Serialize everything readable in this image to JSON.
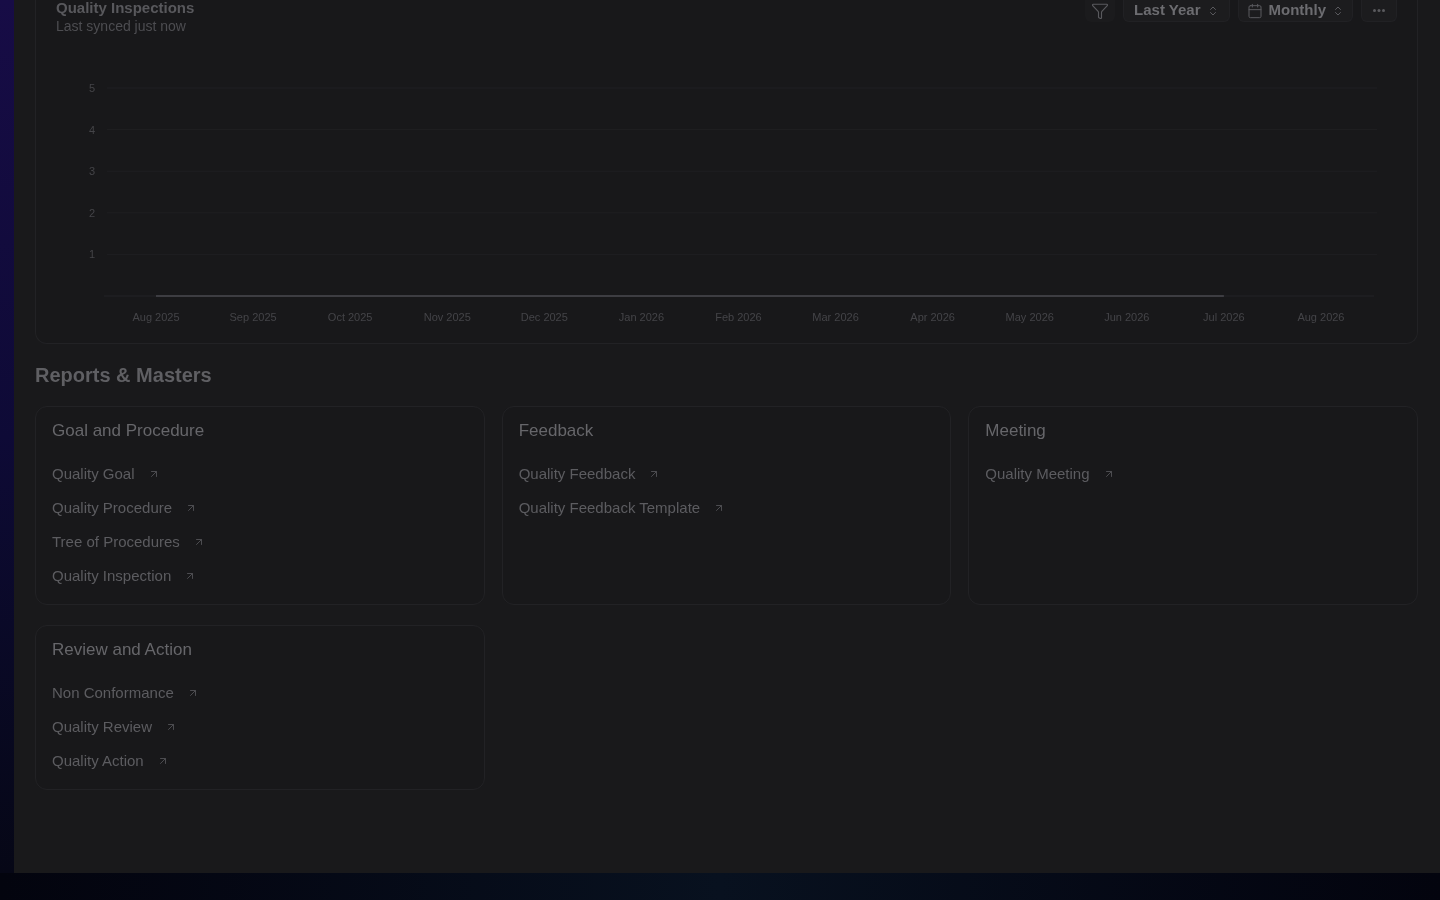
{
  "chart_card": {
    "title": "Quality Inspections",
    "subtitle": "Last synced just now",
    "range_select": {
      "value": "Last Year"
    },
    "interval_select": {
      "value": "Monthly"
    },
    "chart_data": {
      "type": "line",
      "categories": [
        "Aug 2025",
        "Sep 2025",
        "Oct 2025",
        "Nov 2025",
        "Dec 2025",
        "Jan 2026",
        "Feb 2026",
        "Mar 2026",
        "Apr 2026",
        "May 2026",
        "Jun 2026",
        "Jul 2026",
        "Aug 2026"
      ],
      "series": [
        {
          "color": "#3d3d42",
          "values": [
            0,
            0,
            0,
            0,
            0,
            0,
            0,
            0,
            0,
            0,
            0,
            0,
            null
          ]
        }
      ],
      "ylim": [
        0,
        5
      ],
      "yticks": [
        1,
        2,
        3,
        4,
        5
      ]
    }
  },
  "reports": {
    "title": "Reports & Masters",
    "groups": [
      {
        "title": "Goal and Procedure",
        "links": [
          "Quality Goal",
          "Quality Procedure",
          "Tree of Procedures",
          "Quality Inspection"
        ]
      },
      {
        "title": "Feedback",
        "links": [
          "Quality Feedback",
          "Quality Feedback Template"
        ]
      },
      {
        "title": "Meeting",
        "links": [
          "Quality Meeting"
        ]
      },
      {
        "title": "Review and Action",
        "links": [
          "Non Conformance",
          "Quality Review",
          "Quality Action"
        ]
      }
    ]
  }
}
